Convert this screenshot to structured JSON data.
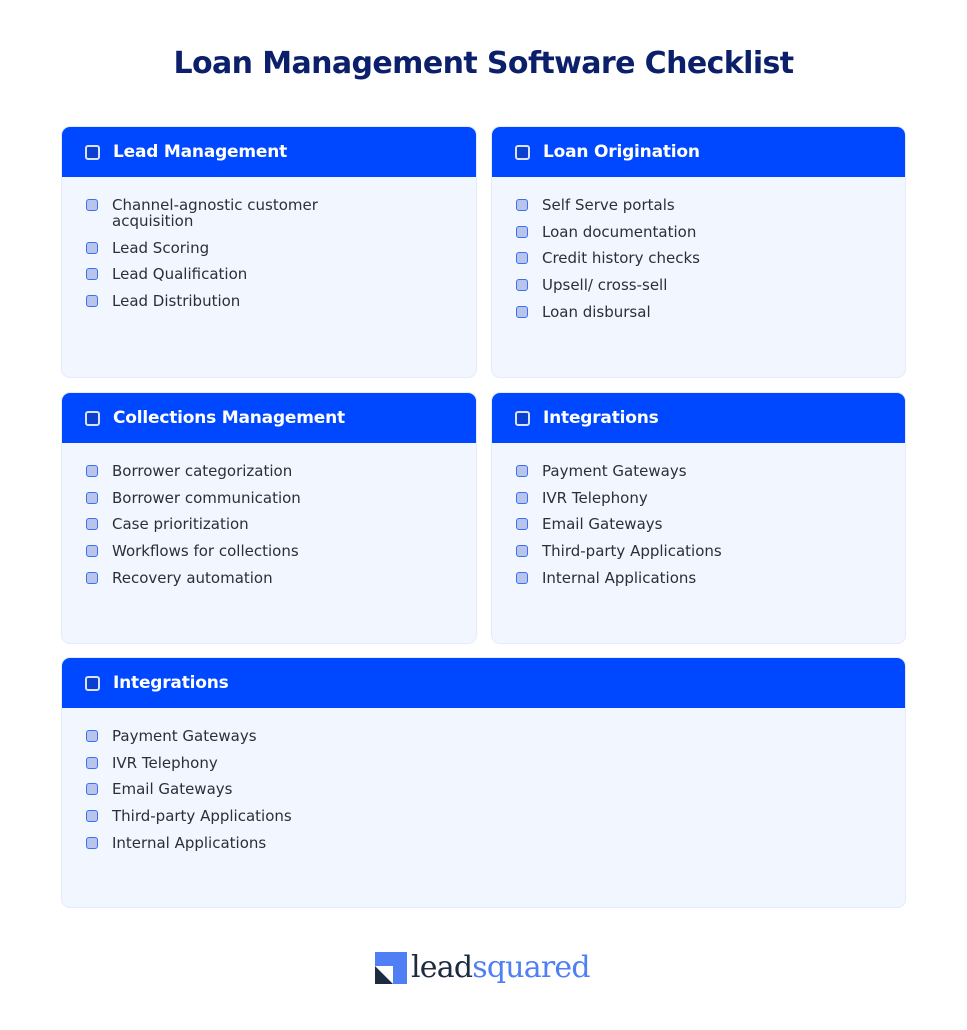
{
  "title": "Loan Management Software Checklist",
  "colors": {
    "title": "#0b1f6b",
    "header_bg": "#0048ff",
    "card_bg": "#f1f6ff",
    "checkbox_border": "#3d6ff5",
    "checkbox_fill": "#b9c4ea",
    "logo_dark": "#1c2b3f",
    "logo_blue": "#4f7ef5"
  },
  "cards": [
    {
      "heading": "Lead Management",
      "items": [
        "Channel-agnostic customer acquisition",
        "Lead Scoring",
        "Lead Qualification",
        "Lead Distribution"
      ]
    },
    {
      "heading": "Loan Origination",
      "items": [
        "Self Serve portals",
        "Loan documentation",
        "Credit history checks",
        "Upsell/ cross-sell",
        "Loan disbursal"
      ]
    },
    {
      "heading": "Collections Management",
      "items": [
        "Borrower categorization",
        "Borrower communication",
        "Case prioritization",
        "Workflows for collections",
        "Recovery automation"
      ]
    },
    {
      "heading": "Integrations",
      "items": [
        "Payment Gateways",
        "IVR Telephony",
        "Email Gateways",
        "Third-party Applications",
        "Internal Applications"
      ]
    },
    {
      "heading": "Integrations",
      "items": [
        "Payment Gateways",
        "IVR Telephony",
        "Email Gateways",
        "Third-party Applications",
        "Internal Applications"
      ]
    }
  ],
  "logo": {
    "part1": "lead",
    "part2": "squared",
    "icon": "leadsquared-logo-icon"
  }
}
